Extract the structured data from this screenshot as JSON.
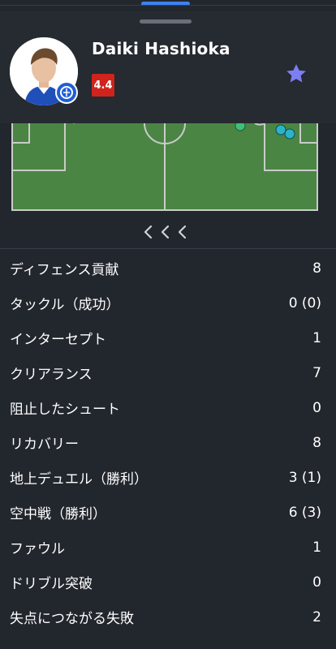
{
  "player": {
    "name": "Daiki Hashioka",
    "rating": "4.4",
    "favorite_icon": "star-icon",
    "rating_color": "#d0231c"
  },
  "heatmap": {
    "navigation_arrows": "< < <"
  },
  "stats": [
    {
      "label": "ディフェンス貢献",
      "value": "8"
    },
    {
      "label": "タックル（成功）",
      "value": "0 (0)"
    },
    {
      "label": "インターセプト",
      "value": "1"
    },
    {
      "label": "クリアランス",
      "value": "7"
    },
    {
      "label": "阻止したシュート",
      "value": "0"
    },
    {
      "label": "リカバリー",
      "value": "8"
    },
    {
      "label": "地上デュエル（勝利）",
      "value": "3 (1)"
    },
    {
      "label": "空中戦（勝利）",
      "value": "6 (3)"
    },
    {
      "label": "ファウル",
      "value": "1"
    },
    {
      "label": "ドリブル突破",
      "value": "0"
    },
    {
      "label": "失点につながる失敗",
      "value": "2"
    }
  ],
  "colors": {
    "background": "#22262d",
    "accent": "#3b82f6",
    "pitch": "#4a8544",
    "star": "#7b7ff0",
    "marker_green": "#3fbf7a",
    "marker_cyan": "#2bb3c9"
  }
}
